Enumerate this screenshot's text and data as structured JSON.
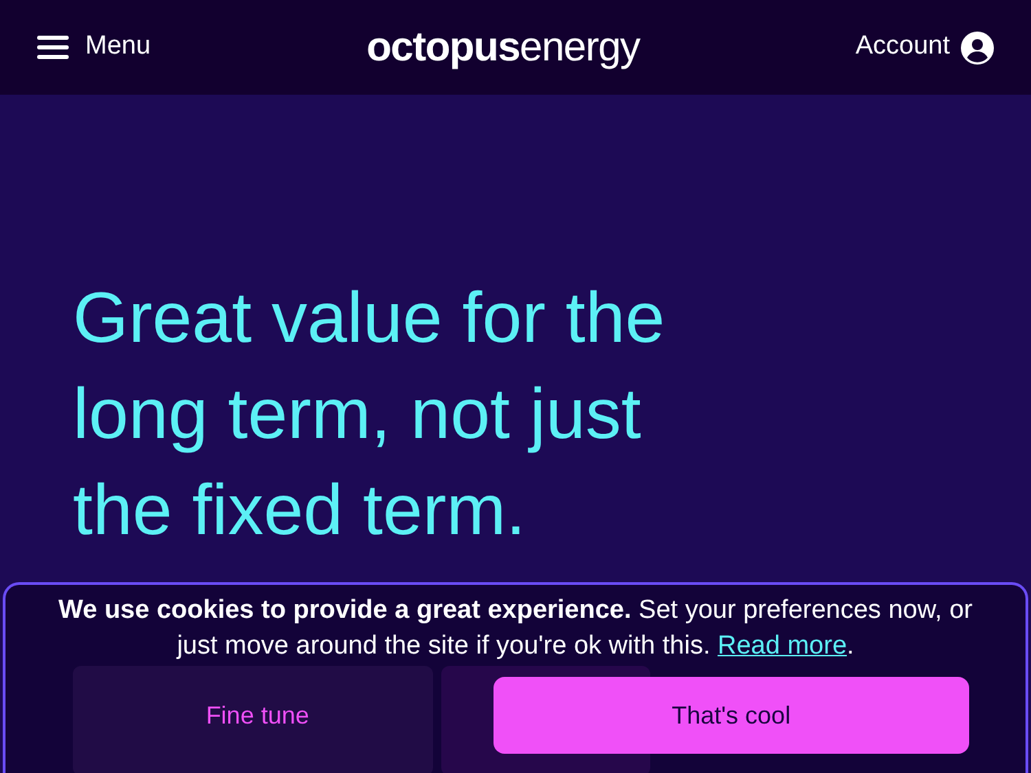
{
  "header": {
    "menu": {
      "label": "Menu"
    },
    "logo": {
      "bold": "octopus",
      "light": "energy"
    },
    "account": {
      "label": "Account"
    }
  },
  "hero": {
    "heading": "Great value for the long term, not just the fixed term."
  },
  "cookie_banner": {
    "message": "**We use cookies to provide a great experience.** Set your preferences now, or just move around the site if you're ok with this.",
    "link": "Read more",
    "trailing": ".",
    "buttons": [
      {
        "label": "Fine tune",
        "kind": "secondary"
      },
      {
        "label": "That's cool",
        "kind": "primary"
      }
    ]
  }
}
